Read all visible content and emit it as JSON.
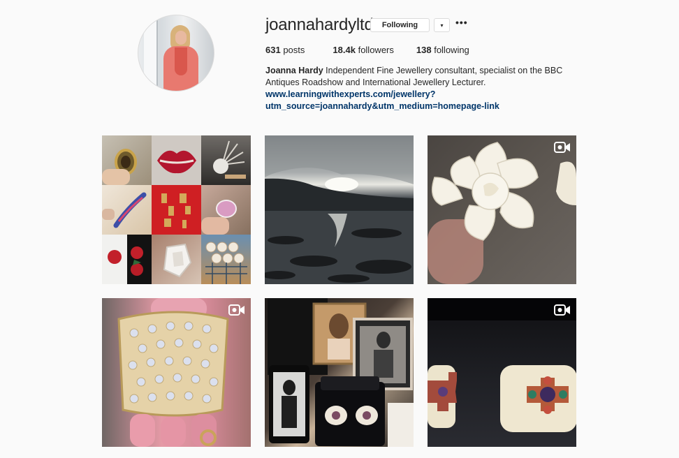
{
  "profile": {
    "username": "joannahardyltd",
    "follow_label": "Following",
    "dropdown_glyph": "▾",
    "more_glyph": "•••",
    "stats": {
      "posts_count": "631",
      "posts_label": "posts",
      "followers_count": "18.4k",
      "followers_label": "followers",
      "following_count": "138",
      "following_label": "following"
    },
    "bio": {
      "name": "Joanna Hardy",
      "text": " Independent Fine Jewellery consultant, specialist on the BBC Antiques Roadshow and International Jewellery Lecturer.",
      "link_line1": "www.learningwithexperts.com/jewellery?",
      "link_line2": "utm_source=joannahardy&utm_medium=homepage-link"
    }
  },
  "colors": {
    "background": "#fafafa",
    "text": "#262626",
    "link": "#003569",
    "border": "#dbdbdb"
  },
  "posts": [
    {
      "icon": "photo-collage",
      "video": false
    },
    {
      "icon": "sea-landscape",
      "video": false
    },
    {
      "icon": "white-flower",
      "video": true
    },
    {
      "icon": "diamond-cuff",
      "video": true
    },
    {
      "icon": "photos-and-earrings",
      "video": false
    },
    {
      "icon": "enamel-cuffs",
      "video": true
    }
  ]
}
